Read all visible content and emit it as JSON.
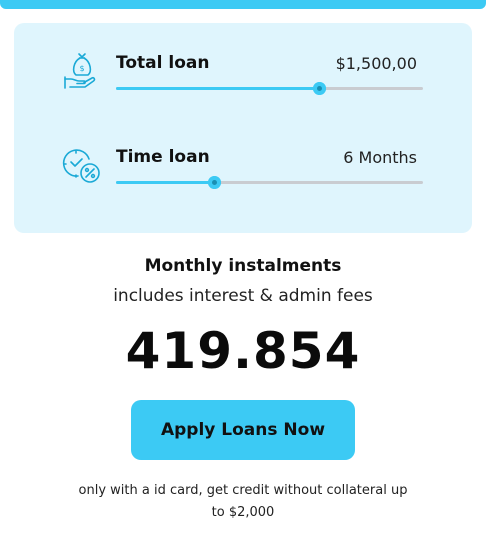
{
  "colors": {
    "accent": "#3ccaf4",
    "card_bg": "#dff5fd",
    "track": "#c9ccd1",
    "icon": "#1aa9d6"
  },
  "calculator": {
    "total_loan": {
      "icon": "money-bag-hand-icon",
      "label": "Total loan",
      "value": "$1,500,00",
      "slider_fraction": 0.66
    },
    "time_loan": {
      "icon": "clock-percent-icon",
      "label": "Time loan",
      "value": "6 Months",
      "slider_fraction": 0.32
    }
  },
  "summary": {
    "title": "Monthly instalments",
    "subtitle": "includes interest & admin fees",
    "amount": "419.854"
  },
  "cta": {
    "label": "Apply Loans Now"
  },
  "note": "only with a id card, get credit without collateral up to $2,000"
}
